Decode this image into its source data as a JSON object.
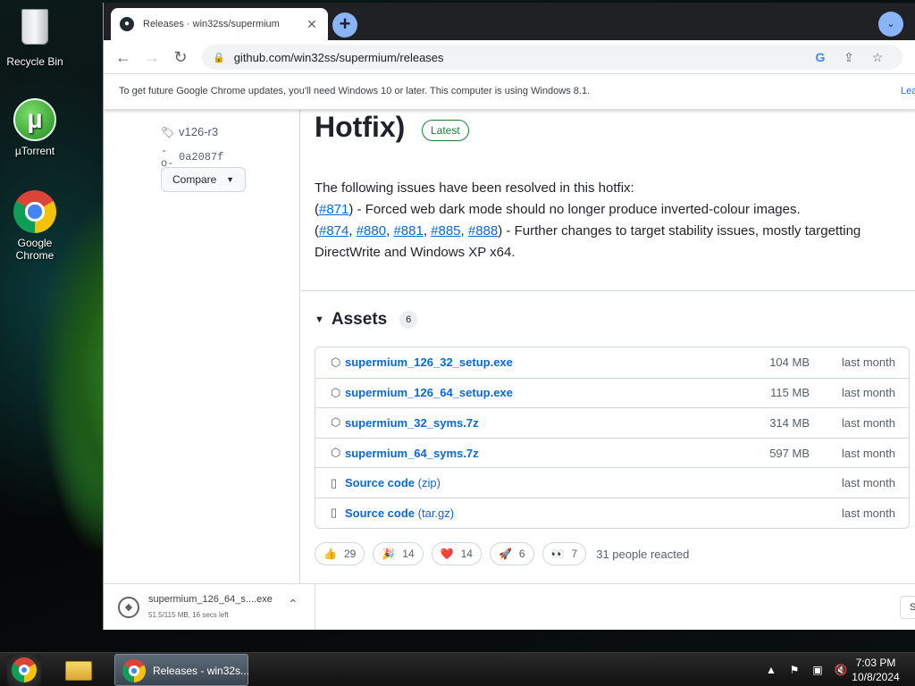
{
  "desktop": {
    "icons": [
      {
        "label": "Recycle Bin",
        "icon": "recycle-bin-icon"
      },
      {
        "label": "µTorrent",
        "icon": "utorrent-icon"
      },
      {
        "label": "Google Chrome",
        "icon": "chrome-icon"
      }
    ]
  },
  "browser": {
    "tab": {
      "title": "Releases · win32ss/supermium",
      "icon": "github-icon",
      "close": "✕"
    },
    "new_tab": "+",
    "omnibox": {
      "url": "github.com/win32ss/supermium/releases"
    },
    "infobar": {
      "message": "To get future Google Chrome updates, you'll need Windows 10 or later. This computer is using Windows 8.1.",
      "link": "Lea"
    }
  },
  "release": {
    "tag": "v126-r3",
    "commit": "0a2087f",
    "compare_label": "Compare",
    "title": "Hotfix)",
    "badge": "Latest",
    "body": {
      "intro": "The following issues have been resolved in this hotfix:",
      "line1_link": "#871",
      "line1_text": " - Forced web dark mode should no longer produce inverted-colour images.",
      "line2_links": [
        "#874",
        "#880",
        "#881",
        "#885",
        "#888"
      ],
      "line2_text": " - Further changes to target stability issues, mostly targetting DirectWrite and Windows XP x64."
    },
    "assets": {
      "label": "Assets",
      "count": "6",
      "items": [
        {
          "name": "supermium_126_32_setup.exe",
          "ext": "",
          "size": "104 MB",
          "date": "last month",
          "icon": "package-icon"
        },
        {
          "name": "supermium_126_64_setup.exe",
          "ext": "",
          "size": "115 MB",
          "date": "last month",
          "icon": "package-icon"
        },
        {
          "name": "supermium_32_syms.7z",
          "ext": "",
          "size": "314 MB",
          "date": "last month",
          "icon": "package-icon"
        },
        {
          "name": "supermium_64_syms.7z",
          "ext": "",
          "size": "597 MB",
          "date": "last month",
          "icon": "package-icon"
        },
        {
          "name": "Source code",
          "ext": " (zip)",
          "size": "",
          "date": "last month",
          "icon": "file-zip-icon"
        },
        {
          "name": "Source code",
          "ext": " (tar.gz)",
          "size": "",
          "date": "last month",
          "icon": "file-zip-icon"
        }
      ]
    },
    "reactions": [
      {
        "emoji": "👍",
        "count": "29"
      },
      {
        "emoji": "🎉",
        "count": "14"
      },
      {
        "emoji": "❤️",
        "count": "14"
      },
      {
        "emoji": "🚀",
        "count": "6"
      },
      {
        "emoji": "👀",
        "count": "7"
      }
    ],
    "reaction_summary": "31 people reacted"
  },
  "download": {
    "filename": "supermium_126_64_s....exe",
    "status": "51.5/115 MB, 16 secs left",
    "more": "S"
  },
  "taskbar": {
    "chrome_label": "Releases - win32s...",
    "time": "7:03 PM",
    "date": "10/8/2024"
  },
  "colors": {
    "link": "#0969da",
    "latest_badge": "#1a7f37",
    "accent": "#8ab4f8"
  }
}
